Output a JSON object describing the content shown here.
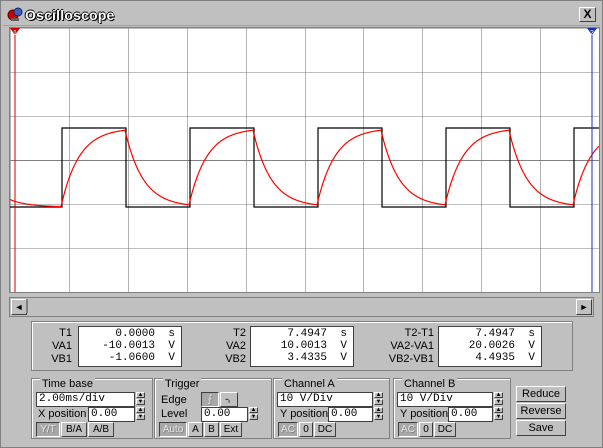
{
  "window": {
    "title": "Oscilloscope",
    "close_glyph": "X",
    "title_icon": "oscilloscope-icon"
  },
  "display": {
    "cursor_1_marker": "1",
    "cursor_2_marker": "2",
    "grid": true,
    "background_color": "#ffffff",
    "grid_color": "#808080",
    "trace_colors": {
      "channel_a": "#000000",
      "channel_b": "#ff0000"
    }
  },
  "scrollbar": {
    "left_arrow": "◄",
    "right_arrow": "►"
  },
  "readout": {
    "col1": {
      "labels": [
        "T1",
        "VA1",
        "VB1"
      ],
      "values": [
        "0.0000",
        "-10.0013",
        "-1.0600"
      ],
      "units": [
        "s",
        "V",
        "V"
      ]
    },
    "col2": {
      "labels": [
        "T2",
        "VA2",
        "VB2"
      ],
      "values": [
        "7.4947",
        "10.0013",
        "3.4335"
      ],
      "units": [
        "s",
        "V",
        "V"
      ]
    },
    "col3": {
      "labels": [
        "T2-T1",
        "VA2-VA1",
        "VB2-VB1"
      ],
      "values": [
        "7.4947",
        "20.0026",
        "4.4935"
      ],
      "units": [
        "s",
        "V",
        "V"
      ]
    }
  },
  "time_base": {
    "title": "Time base",
    "scale": "2.00ms/div",
    "x_position_label": "X position",
    "x_position": "0.00",
    "buttons": [
      "Y/T",
      "B/A",
      "A/B"
    ]
  },
  "trigger": {
    "title": "Trigger",
    "edge_label": "Edge",
    "edge_rising": "⨍",
    "edge_falling": "⌍",
    "level_label": "Level",
    "level": "0.00",
    "buttons": [
      "Auto",
      "A",
      "B",
      "Ext"
    ]
  },
  "channel_a": {
    "title": "Channel A",
    "scale": "10 V/Div",
    "y_position_label": "Y position",
    "y_position": "0.00",
    "buttons": [
      "AC",
      "0",
      "DC"
    ]
  },
  "channel_b": {
    "title": "Channel B",
    "scale": "10 V/Div",
    "y_position_label": "Y position",
    "y_position": "0.00",
    "buttons": [
      "AC",
      "0",
      "DC"
    ]
  },
  "actions": {
    "reduce": "Reduce",
    "reverse": "Reverse",
    "save": "Save"
  }
}
